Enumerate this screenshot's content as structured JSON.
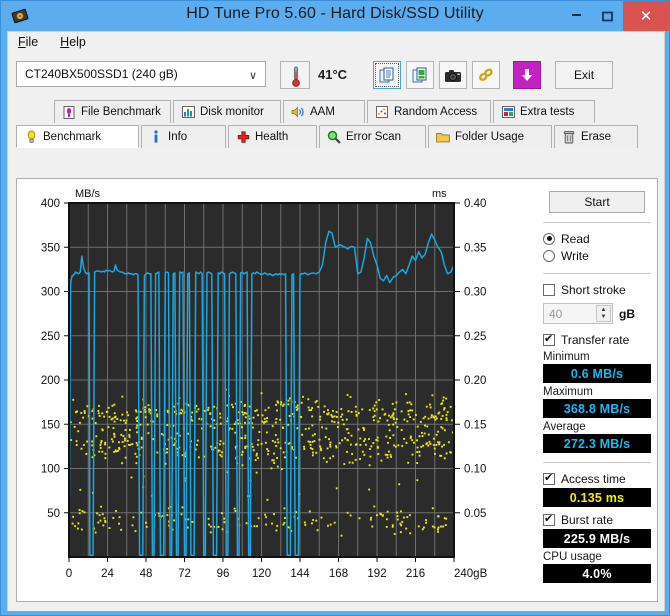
{
  "window": {
    "title": "HD Tune Pro 5.60 - Hard Disk/SSD Utility",
    "app_icon": "hard-disk-icon",
    "minimize": "—",
    "maximize": "▭",
    "close": "✕",
    "titlebar_color": "#5badf0",
    "close_color": "#d9534f"
  },
  "menu": {
    "file": "File",
    "help": "Help"
  },
  "toolbar": {
    "drive_selected": "CT240BX500SSD1 (240 gB)",
    "drive_arrow": "∨",
    "temperature": "41°C",
    "temp_icon": "thermometer-icon",
    "buttons": [
      {
        "name": "copy-text-icon",
        "label": ""
      },
      {
        "name": "copy-image-icon",
        "label": ""
      },
      {
        "name": "screenshot-camera-icon",
        "label": ""
      },
      {
        "name": "link-chain-icon",
        "label": ""
      },
      {
        "name": "save-download-icon",
        "label": ""
      }
    ],
    "exit_label": "Exit"
  },
  "tabs": {
    "top_row": [
      {
        "label": "File Benchmark",
        "icon": "file-benchmark-icon"
      },
      {
        "label": "Disk monitor",
        "icon": "bar-chart-icon"
      },
      {
        "label": "AAM",
        "icon": "speaker-icon"
      },
      {
        "label": "Random Access",
        "icon": "scatter-chart-icon"
      },
      {
        "label": "Extra tests",
        "icon": "grid-chart-icon"
      }
    ],
    "bottom_row": [
      {
        "label": "Benchmark",
        "icon": "bulb-icon",
        "active": true
      },
      {
        "label": "Info",
        "icon": "info-icon",
        "active": false
      },
      {
        "label": "Health",
        "icon": "red-cross-icon",
        "active": false
      },
      {
        "label": "Error Scan",
        "icon": "magnifier-icon",
        "active": false
      },
      {
        "label": "Folder Usage",
        "icon": "folder-icon",
        "active": false
      },
      {
        "label": "Erase",
        "icon": "trash-icon",
        "active": false
      }
    ]
  },
  "panel": {
    "start_label": "Start",
    "read_label": "Read",
    "write_label": "Write",
    "read_selected": true,
    "write_selected": false,
    "short_stroke_label": "Short stroke",
    "short_stroke_checked": false,
    "short_stroke_value": "40",
    "short_stroke_unit": "gB",
    "transfer_rate_label": "Transfer rate",
    "transfer_rate_checked": true,
    "minimum_label": "Minimum",
    "minimum_value": "0.6 MB/s",
    "maximum_label": "Maximum",
    "maximum_value": "368.8 MB/s",
    "average_label": "Average",
    "average_value": "272.3 MB/s",
    "access_time_label": "Access time",
    "access_time_checked": true,
    "access_time_value": "0.135 ms",
    "burst_rate_label": "Burst rate",
    "burst_rate_checked": true,
    "burst_rate_value": "225.9 MB/s",
    "cpu_usage_label": "CPU usage",
    "cpu_usage_value": "4.0%",
    "value_color_cyan": "#21b6ef",
    "value_color_yellow": "#f2f20a",
    "value_color_white": "#ffffff"
  },
  "chart_data": {
    "type": "line",
    "title": "",
    "xlabel": "gB",
    "ylabel": "MB/s",
    "y2label": "ms",
    "xlim": [
      0,
      240
    ],
    "ylim": [
      0,
      400
    ],
    "y2lim": [
      0,
      0.4
    ],
    "grid": true,
    "plot_bg": "#2b2b2b",
    "xticks": [
      0,
      24,
      48,
      72,
      96,
      120,
      144,
      168,
      192,
      216,
      240
    ],
    "xtick_labels": [
      "0",
      "24",
      "48",
      "72",
      "96",
      "120",
      "144",
      "168",
      "192",
      "216",
      "240"
    ],
    "yticks": [
      0,
      50,
      100,
      150,
      200,
      250,
      300,
      350,
      400
    ],
    "ytick_labels": [
      "0",
      "50",
      "100",
      "150",
      "200",
      "250",
      "300",
      "350",
      "400"
    ],
    "y2ticks": [
      0,
      0.05,
      0.1,
      0.15,
      0.2,
      0.25,
      0.3,
      0.35,
      0.4
    ],
    "y2tick_labels": [
      "0.05",
      "0.10",
      "0.15",
      "0.20",
      "0.25",
      "0.30",
      "0.35",
      "0.40"
    ],
    "series": [
      {
        "name": "Transfer rate",
        "color": "#1ba7e0",
        "axis": "left",
        "units": "MB/s",
        "x": [
          0,
          1,
          2,
          2.5,
          3,
          3.5,
          4,
          5,
          6,
          7,
          8,
          9,
          10,
          11,
          12,
          12.5,
          13,
          14,
          15,
          16,
          17,
          18,
          19,
          20,
          21,
          22,
          23,
          24,
          25,
          26,
          27,
          28,
          29,
          30,
          31,
          32,
          33,
          34,
          35,
          36,
          37,
          38,
          39,
          40,
          41,
          42,
          43,
          44,
          45,
          46,
          47,
          48,
          49,
          50,
          51,
          52,
          53,
          54,
          55,
          56,
          57,
          58,
          59,
          60,
          61,
          62,
          63,
          64,
          65,
          66,
          67,
          68,
          69,
          70,
          71,
          72,
          73,
          74,
          75,
          76,
          77,
          78,
          79,
          80,
          81,
          82,
          83,
          84,
          85,
          86,
          87,
          88,
          89,
          90,
          91,
          92,
          93,
          94,
          95,
          96,
          97,
          98,
          99,
          100,
          101,
          102,
          103,
          104,
          105,
          106,
          107,
          108,
          109,
          110,
          111,
          112,
          113,
          114,
          115,
          116,
          117,
          118,
          119,
          120,
          121,
          122,
          123,
          124,
          125,
          126,
          127,
          128,
          129,
          130,
          131,
          132,
          133,
          134,
          135,
          136,
          137,
          138,
          139,
          140,
          141,
          142,
          143,
          144,
          145,
          146,
          147,
          148,
          149,
          150,
          152,
          154,
          156,
          158,
          160,
          162,
          164,
          166,
          168,
          169,
          170,
          171,
          172,
          173,
          174,
          175,
          176,
          178,
          180,
          182,
          184,
          186,
          188,
          190,
          192,
          194,
          196,
          198,
          200,
          202,
          204,
          206,
          208,
          210,
          212,
          214,
          216,
          218,
          220,
          222,
          224,
          226,
          228,
          230,
          232,
          234,
          236,
          238,
          240
        ],
        "y": [
          2,
          310,
          318,
          318,
          319,
          320,
          322,
          321,
          320,
          322,
          340,
          328,
          322,
          320,
          321,
          321,
          2,
          2,
          2,
          322,
          323,
          323,
          323,
          322,
          323,
          322,
          324,
          323,
          324,
          323,
          322,
          323,
          330,
          324,
          323,
          322,
          322,
          321,
          320,
          320,
          321,
          320,
          320,
          319,
          320,
          320,
          319,
          2,
          2,
          2,
          318,
          320,
          321,
          320,
          320,
          2,
          2,
          320,
          321,
          322,
          2,
          2,
          2,
          321,
          322,
          321,
          2,
          2,
          320,
          321,
          2,
          2,
          322,
          321,
          322,
          2,
          2,
          320,
          321,
          2,
          2,
          2,
          322,
          321,
          320,
          322,
          320,
          2,
          2,
          321,
          322,
          321,
          320,
          2,
          2,
          2,
          321,
          320,
          322,
          321,
          320,
          2,
          2,
          320,
          321,
          322,
          321,
          320,
          2,
          2,
          321,
          322,
          320,
          321,
          322,
          2,
          2,
          320,
          321,
          320,
          322,
          321,
          320,
          319,
          320,
          321,
          320,
          319,
          320,
          319,
          318,
          319,
          320,
          319,
          320,
          319,
          320,
          319,
          320,
          2,
          2,
          2,
          319,
          320,
          2,
          2,
          2,
          319,
          320,
          320,
          321,
          320,
          319,
          320,
          321,
          320,
          322,
          330,
          355,
          368,
          366,
          350,
          352,
          353,
          352,
          351,
          350,
          349,
          348,
          350,
          351,
          350,
          320,
          322,
          338,
          360,
          355,
          340,
          330,
          315,
          312,
          318,
          310,
          316,
          318,
          322,
          325,
          320,
          330,
          340,
          335,
          345,
          338,
          342,
          355,
          365,
          358,
          350,
          345,
          330,
          320,
          322,
          330,
          345,
          362
        ]
      },
      {
        "name": "Access time",
        "color": "#f2f20a",
        "axis": "right",
        "units": "ms",
        "description": "Scattered yellow dots, two dense bands around 0.145-0.175 ms and 0.115-0.135 ms across 0-240 gB, with a sparser band near 0.03-0.05 ms",
        "mean": 0.135
      }
    ]
  }
}
